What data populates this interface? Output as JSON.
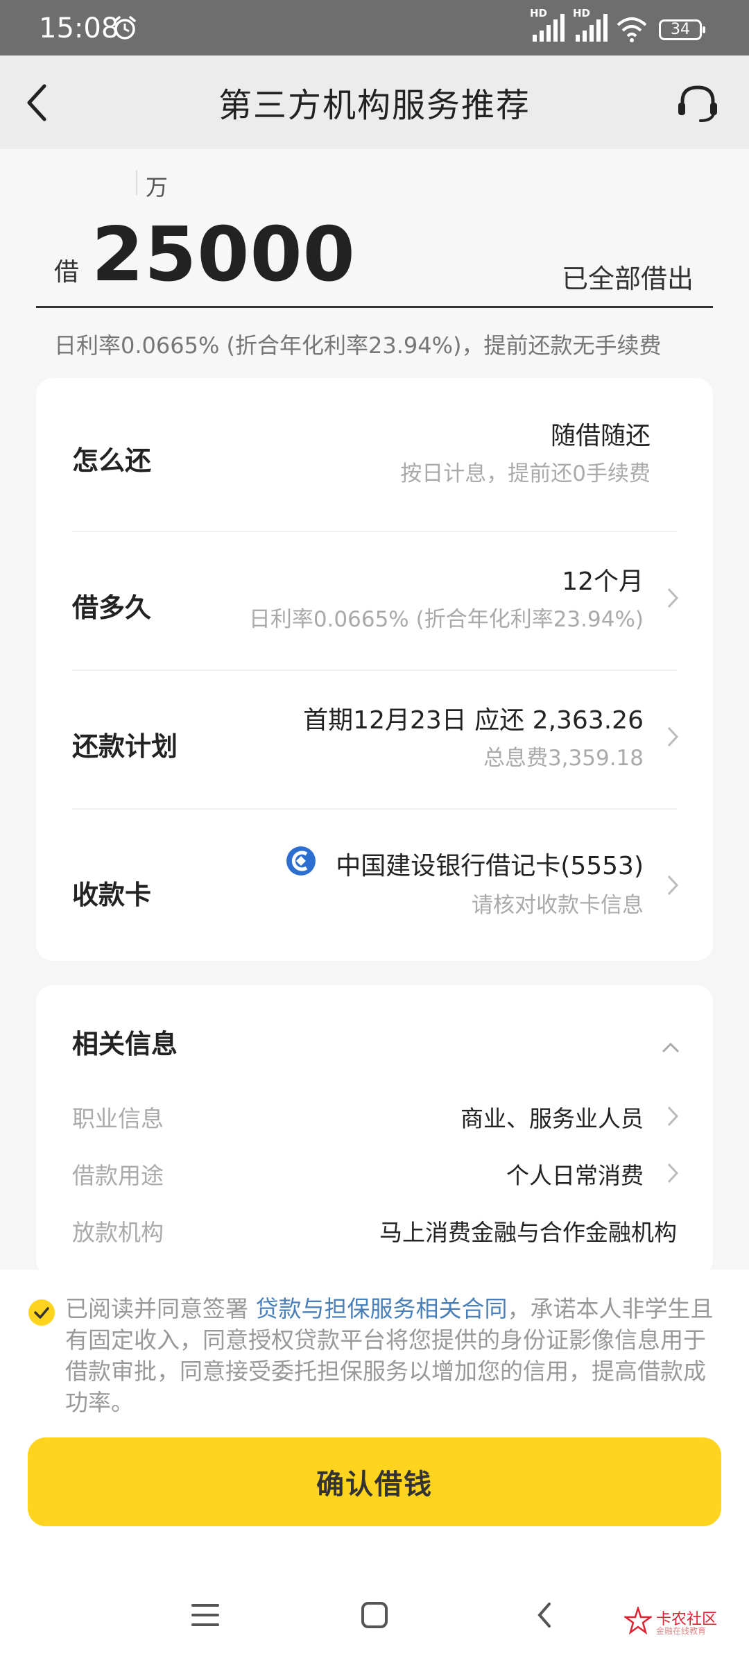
{
  "status_bar": {
    "time": "15:08",
    "battery": "34",
    "hd1": "HD",
    "hd2": "HD"
  },
  "header": {
    "title": "第三方机构服务推荐"
  },
  "amount": {
    "unit": "万",
    "prefix": "借",
    "value": "25000",
    "status": "已全部借出",
    "rate_note": "日利率0.0665% (折合年化利率23.94%)，提前还款无手续费"
  },
  "loan_details": {
    "repay_method": {
      "label": "怎么还",
      "value": "随借随还",
      "sub": "按日计息，提前还0手续费"
    },
    "term": {
      "label": "借多久",
      "value": "12个月",
      "sub": "日利率0.0665% (折合年化利率23.94%)"
    },
    "plan": {
      "label": "还款计划",
      "value": "首期12月23日 应还 2,363.26",
      "sub": "总息费3,359.18"
    },
    "card": {
      "label": "收款卡",
      "value": "中国建设银行借记卡(5553)",
      "sub": "请核对收款卡信息"
    }
  },
  "related_info": {
    "title": "相关信息",
    "items": [
      {
        "label": "职业信息",
        "value": "商业、服务业人员"
      },
      {
        "label": "借款用途",
        "value": "个人日常消费"
      },
      {
        "label": "放款机构",
        "value": "马上消费金融与合作金融机构"
      }
    ]
  },
  "agreement": {
    "prefix": "已阅读并同意签署 ",
    "link": "贷款与担保服务相关合同",
    "suffix": "，承诺本人非学生且有固定收入，同意授权贷款平台将您提供的身份证影像信息用于借款审批，同意接受委托担保服务以增加您的信用，提高借款成功率。",
    "checked": true
  },
  "confirm_button": {
    "label": "确认借钱"
  },
  "watermark": {
    "title": "卡农社区",
    "subtitle": "金融在线教育"
  },
  "colors": {
    "accent": "#ffd41e",
    "link": "#4a7fb8",
    "bank_blue": "#2d6fd0",
    "status_bar": "#6e6e6e"
  }
}
